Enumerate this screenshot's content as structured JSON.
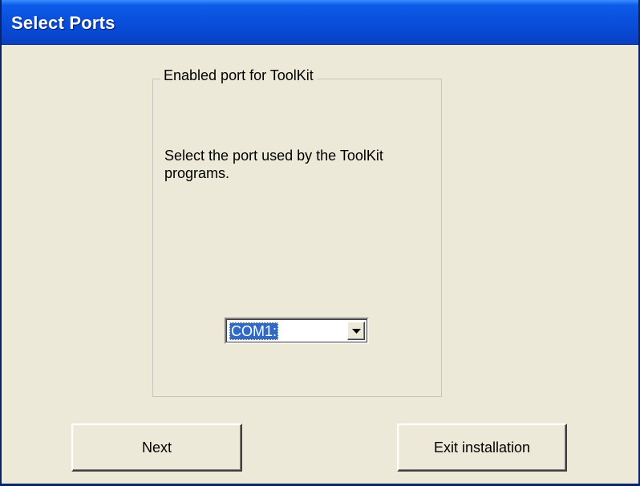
{
  "window": {
    "title": "Select Ports"
  },
  "group": {
    "legend": "Enabled port for ToolKit",
    "instruction": "Select the port used by the ToolKit programs."
  },
  "port_select": {
    "selected": "COM1:",
    "icon": "chevron-down-icon"
  },
  "buttons": {
    "next_label": "Next",
    "exit_label": "Exit installation"
  },
  "colors": {
    "titlebar": "#0a50dc",
    "dialog_bg": "#ece9d8",
    "selection": "#316ac5"
  }
}
